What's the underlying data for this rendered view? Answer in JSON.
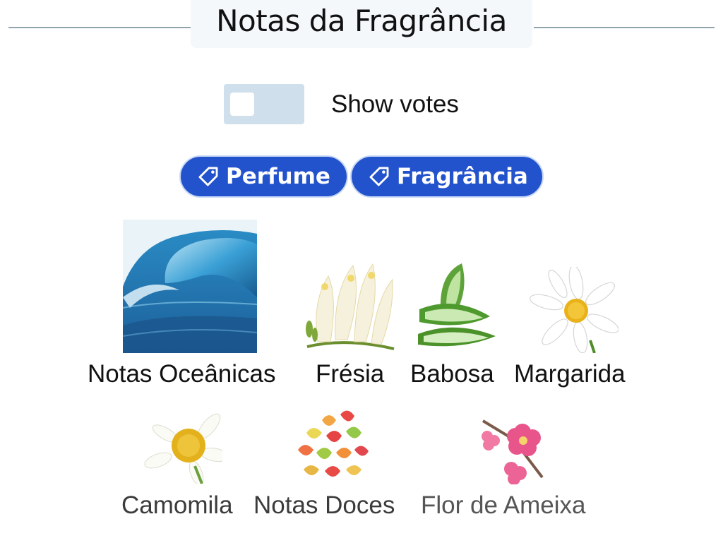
{
  "header": {
    "title": "Notas da Fragrância"
  },
  "toggle": {
    "label": "Show votes",
    "checked": false
  },
  "tags": [
    {
      "label": "Perfume",
      "icon": "tag-icon"
    },
    {
      "label": "Fragrância",
      "icon": "tag-icon"
    }
  ],
  "notes": [
    {
      "label": "Notas Oceânicas",
      "image": "ocean-wave-image"
    },
    {
      "label": "Frésia",
      "image": "freesia-flowers-image"
    },
    {
      "label": "Babosa",
      "image": "aloe-vera-image"
    },
    {
      "label": "Margarida",
      "image": "daisy-flower-image"
    },
    {
      "label": "Camomila",
      "image": "chamomile-flower-image"
    },
    {
      "label": "Notas Doces",
      "image": "gummy-candies-image"
    },
    {
      "label": "Flor de Ameixa",
      "image": "plum-blossom-image"
    }
  ],
  "colors": {
    "accent": "#2353cc",
    "toggle_bg": "#cfdfeb",
    "divider": "#8fa4ad",
    "label_primary": "#111111",
    "label_faded": "#4a4a4a"
  }
}
